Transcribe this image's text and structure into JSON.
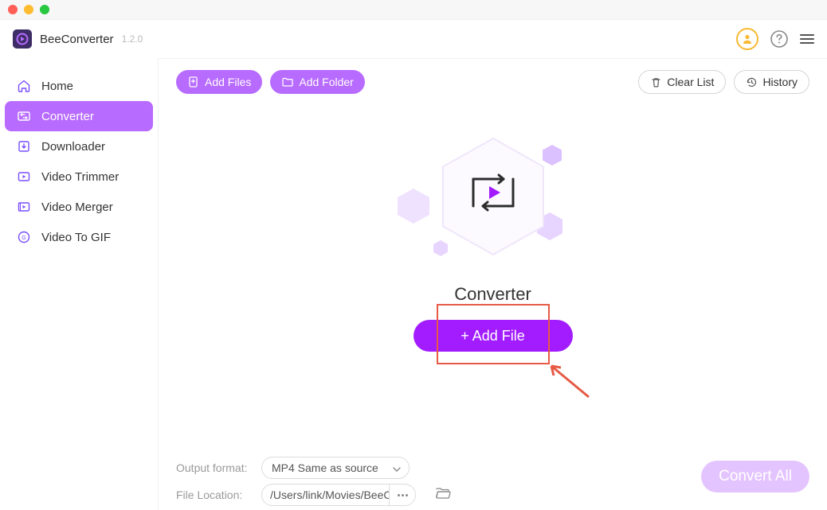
{
  "header": {
    "app_name": "BeeConverter",
    "version": "1.2.0"
  },
  "sidebar": {
    "items": [
      {
        "label": "Home",
        "icon": "home"
      },
      {
        "label": "Converter",
        "icon": "converter",
        "active": true
      },
      {
        "label": "Downloader",
        "icon": "downloader"
      },
      {
        "label": "Video Trimmer",
        "icon": "trimmer"
      },
      {
        "label": "Video Merger",
        "icon": "merger"
      },
      {
        "label": "Video To GIF",
        "icon": "gif"
      }
    ]
  },
  "toolbar": {
    "add_files": "Add Files",
    "add_folder": "Add Folder",
    "clear_list": "Clear List",
    "history": "History"
  },
  "center": {
    "title": "Converter",
    "add_file_button": "+ Add File"
  },
  "footer": {
    "output_format_label": "Output format:",
    "output_format_value": "MP4 Same as source",
    "file_location_label": "File Location:",
    "file_location_value": "/Users/link/Movies/BeeC",
    "convert_all": "Convert All"
  }
}
